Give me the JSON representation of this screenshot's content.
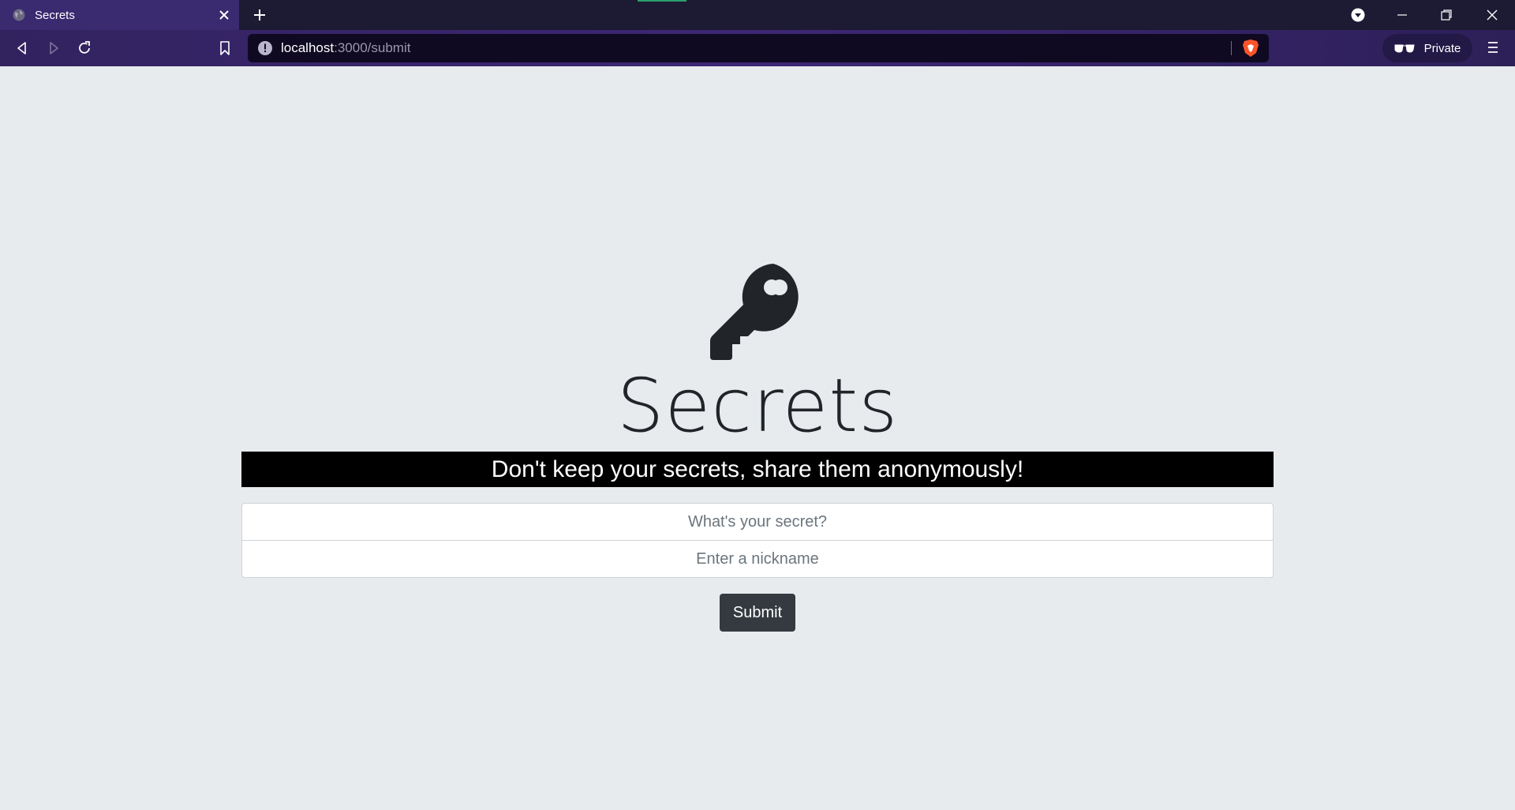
{
  "browser": {
    "tab": {
      "title": "Secrets"
    },
    "url": {
      "host": "localhost",
      "rest": ":3000/submit"
    },
    "private_label": "Private"
  },
  "page": {
    "title": "Secrets",
    "tagline": "Don't keep your secrets, share them anonymously!",
    "form": {
      "secret_placeholder": "What's your secret?",
      "secret_value": "",
      "nickname_placeholder": "Enter a nickname",
      "nickname_value": "",
      "submit_label": "Submit"
    }
  },
  "icons": {
    "key": "key-icon",
    "globe": "globe-icon",
    "close": "close-icon",
    "new_tab": "plus-icon",
    "back": "back-icon",
    "forward": "forward-icon",
    "reload": "reload-icon",
    "bookmark": "bookmark-icon",
    "info": "info-icon",
    "brave": "brave-shield-icon",
    "private": "private-glasses-icon",
    "menu": "hamburger-menu-icon"
  },
  "colors": {
    "page_background": "#e8ebee",
    "tab_active": "#3a2a70",
    "tagline_background": "#000000",
    "button_background": "#343a40",
    "text_dark": "#212529"
  }
}
